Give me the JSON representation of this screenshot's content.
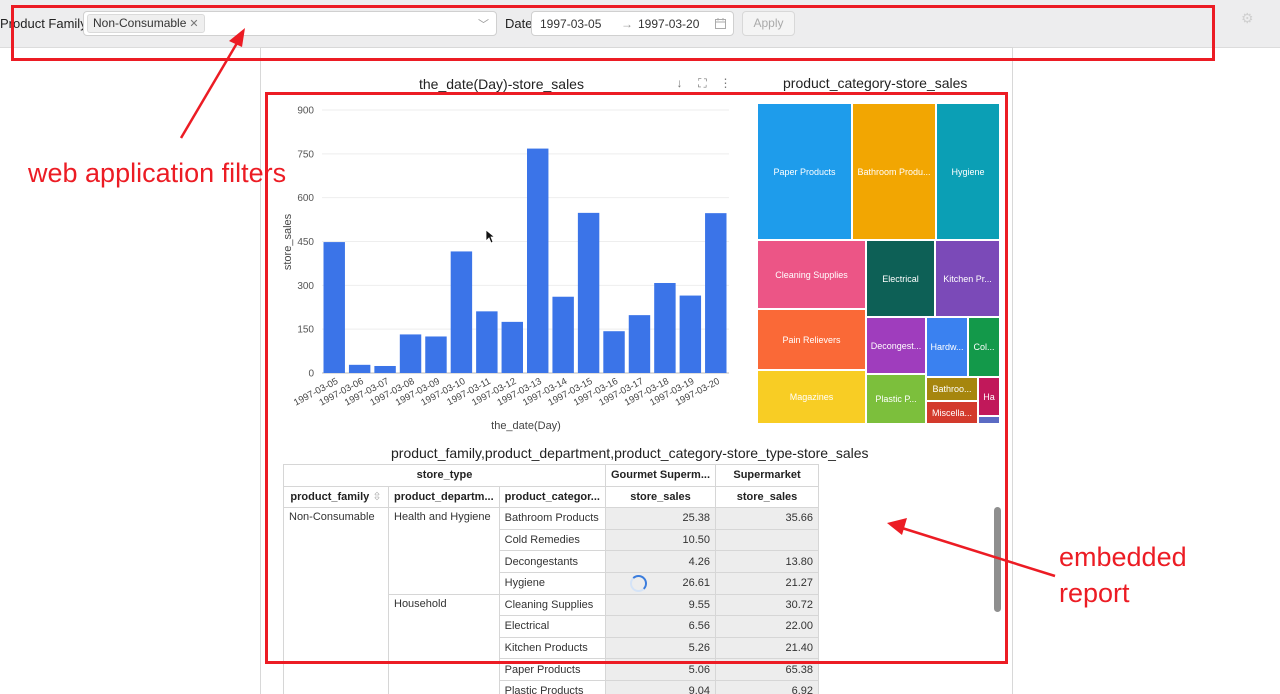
{
  "filters": {
    "product_family_label": "Product Family",
    "product_family_tag": "Non-Consumable",
    "date_label": "Date",
    "date_start": "1997-03-05",
    "date_sep": "→",
    "date_end": "1997-03-20",
    "apply_label": "Apply"
  },
  "bar_panel": {
    "title": "the_date(Day)-store_sales"
  },
  "treemap_panel": {
    "title": "product_category-store_sales",
    "tiles": [
      {
        "label": "Paper Products",
        "color": "#1e9ceb"
      },
      {
        "label": "Bathroom Produ...",
        "color": "#f2a602"
      },
      {
        "label": "Hygiene",
        "color": "#0b9fb5"
      },
      {
        "label": "Cleaning Supplies",
        "color": "#ec5586"
      },
      {
        "label": "Electrical",
        "color": "#0d6056"
      },
      {
        "label": "Kitchen Pr...",
        "color": "#7b4ab8"
      },
      {
        "label": "Pain Relievers",
        "color": "#fa6937"
      },
      {
        "label": "Decongest...",
        "color": "#9f3dbd"
      },
      {
        "label": "Hardw...",
        "color": "#3a81f0"
      },
      {
        "label": "Col...",
        "color": "#13994a"
      },
      {
        "label": "Magazines",
        "color": "#f8cd24"
      },
      {
        "label": "Plastic P...",
        "color": "#7cbf3c"
      },
      {
        "label": "Bathroo...",
        "color": "#a6860e"
      },
      {
        "label": "Ha",
        "color": "#c1185a"
      },
      {
        "label": "Miscella...",
        "color": "#d33a2c"
      },
      {
        "label": "",
        "color": "#5b6bc4"
      }
    ]
  },
  "chart_data": {
    "type": "bar",
    "title": "the_date(Day)-store_sales",
    "xlabel": "the_date(Day)",
    "ylabel": "store_sales",
    "ylim": [
      0,
      900
    ],
    "yticks": [
      "0",
      "150",
      "300",
      "450",
      "600",
      "750",
      "900"
    ],
    "categories": [
      "1997-03-05",
      "1997-03-06",
      "1997-03-07",
      "1997-03-08",
      "1997-03-09",
      "1997-03-10",
      "1997-03-11",
      "1997-03-12",
      "1997-03-13",
      "1997-03-14",
      "1997-03-15",
      "1997-03-16",
      "1997-03-17",
      "1997-03-18",
      "1997-03-19",
      "1997-03-20"
    ],
    "values": [
      448,
      28,
      24,
      132,
      125,
      416,
      211,
      175,
      768,
      261,
      548,
      143,
      198,
      308,
      265,
      547
    ],
    "color": "#3b74e8",
    "grid": true
  },
  "pivot_panel": {
    "title": "product_family,product_department,product_category-store_type-store_sales",
    "h_store_type": "store_type",
    "h_gourmet": "Gourmet Superm...",
    "h_super": "Supermarket",
    "h_family": "product_family",
    "h_family_sort": "⇳",
    "h_department": "product_departm...",
    "h_category": "product_categor...",
    "h_sales1": "store_sales",
    "h_sales2": "store_sales",
    "family": "Non-Consumable",
    "dept1": "Health and Hygiene",
    "dept2": "Household",
    "rows": [
      {
        "category": "Bathroom Products",
        "gourmet": "25.38",
        "super": "35.66"
      },
      {
        "category": "Cold Remedies",
        "gourmet": "10.50",
        "super": ""
      },
      {
        "category": "Decongestants",
        "gourmet": "4.26",
        "super": "13.80"
      },
      {
        "category": "Hygiene",
        "gourmet": "26.61",
        "super": "21.27"
      },
      {
        "category": "Cleaning Supplies",
        "gourmet": "9.55",
        "super": "30.72"
      },
      {
        "category": "Electrical",
        "gourmet": "6.56",
        "super": "22.00"
      },
      {
        "category": "Kitchen Products",
        "gourmet": "5.26",
        "super": "21.40"
      },
      {
        "category": "Paper Products",
        "gourmet": "5.06",
        "super": "65.38"
      },
      {
        "category": "Plastic Products",
        "gourmet": "9.04",
        "super": "6.92"
      }
    ]
  },
  "annotations": {
    "filters_note": "web application filters",
    "report_note_1": "embedded",
    "report_note_2": "report",
    "color": "#ec1c24"
  }
}
